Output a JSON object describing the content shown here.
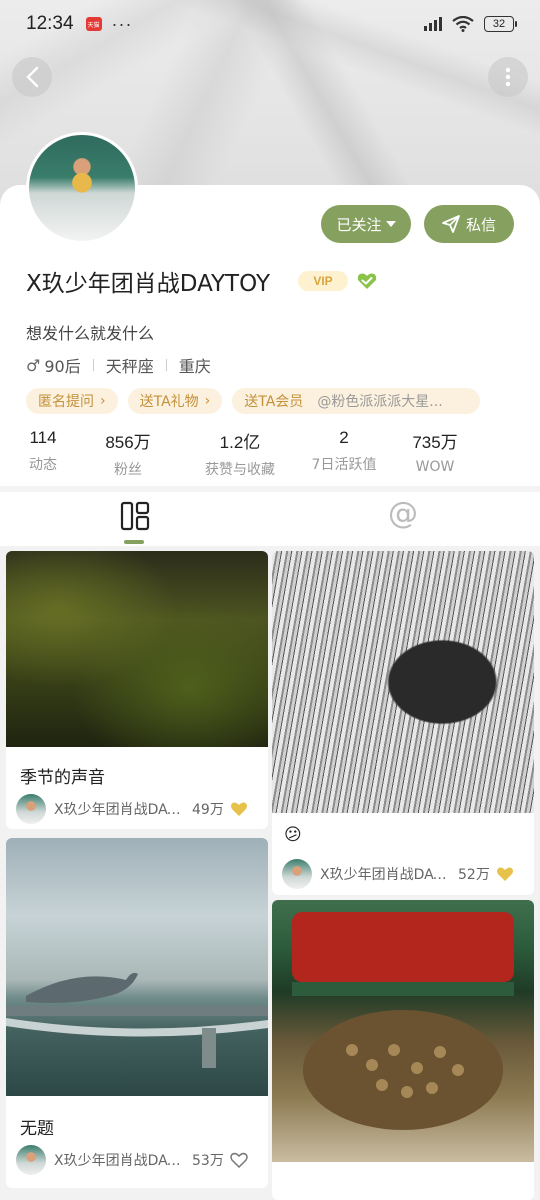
{
  "status_bar": {
    "time": "12:34",
    "app_badge": "天猫",
    "more_dots": "···",
    "battery": "32"
  },
  "profile": {
    "username": "X玖少年团肖战DAYTOY",
    "vip_label": "VIP",
    "bio": "想发什么就发什么",
    "gender_symbol": "♂",
    "age_group": "90后",
    "zodiac": "天秤座",
    "city": "重庆",
    "follow_button": "已关注",
    "message_button": "私信",
    "accent_color": "#85a05f"
  },
  "tags": [
    {
      "label": "匿名提问"
    },
    {
      "label": "送TA礼物"
    },
    {
      "label": "送TA会员",
      "mention": "@粉色派派派大星..."
    }
  ],
  "stats": [
    {
      "value": "114",
      "label": "动态"
    },
    {
      "value": "856万",
      "label": "粉丝"
    },
    {
      "value": "1.2亿",
      "label": "获赞与收藏"
    },
    {
      "value": "2",
      "label": "7日活跃值"
    },
    {
      "value": "735万",
      "label": "WOW"
    }
  ],
  "tabs": {
    "grid_icon": "grid-icon",
    "mention_icon": "@"
  },
  "feed": [
    {
      "title": "季节的声音",
      "author": "X玖少年团肖战DAYTOY",
      "likes": "49万",
      "liked": true
    },
    {
      "title": "😕",
      "author": "X玖少年团肖战DAYTOY",
      "likes": "52万",
      "liked": true
    },
    {
      "title": "无题",
      "author": "X玖少年团肖战DAYTOY",
      "likes": "53万",
      "liked": false
    },
    {
      "title": "",
      "author": "",
      "likes": "",
      "liked": false
    }
  ]
}
